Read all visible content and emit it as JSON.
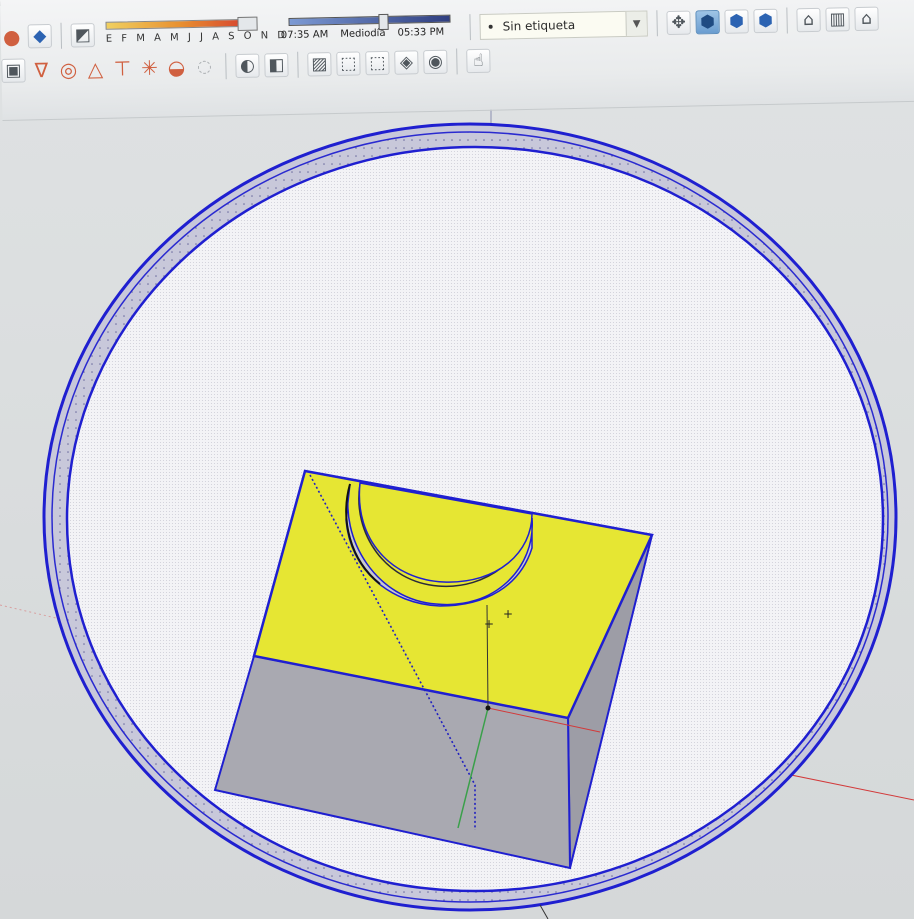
{
  "toolbar": {
    "months": "E F M A M J J A S O N D",
    "time_start": "07:35 AM",
    "time_mid": "Mediodía",
    "time_end": "05:33 PM",
    "tag_selected": "Sin etiqueta",
    "row1_tools": [
      {
        "name": "orbit-red-icon",
        "glyph": "●"
      },
      {
        "name": "component-icon",
        "glyph": "◆"
      },
      {
        "name": "eraser-icon",
        "glyph": "◩"
      }
    ],
    "view_tools": [
      {
        "name": "position-camera-icon",
        "glyph": "✥"
      },
      {
        "name": "view-iso-icon",
        "glyph": "⬢"
      },
      {
        "name": "view-top-icon",
        "glyph": "⬢"
      },
      {
        "name": "view-front-icon",
        "glyph": "⬢"
      },
      {
        "name": "warehouse-icon",
        "glyph": "⌂"
      },
      {
        "name": "extension-icon",
        "glyph": "▥"
      },
      {
        "name": "home-icon",
        "glyph": "⌂"
      }
    ],
    "row2_tools": [
      {
        "name": "photo-match-icon",
        "glyph": "▣"
      },
      {
        "name": "funnel-icon",
        "glyph": "∇"
      },
      {
        "name": "circle-target-icon",
        "glyph": "◎"
      },
      {
        "name": "triangle-icon",
        "glyph": "△"
      },
      {
        "name": "tack-icon",
        "glyph": "⊤"
      },
      {
        "name": "sun-icon",
        "glyph": "✳"
      },
      {
        "name": "drop-icon",
        "glyph": "◒"
      },
      {
        "name": "disabled-icon",
        "glyph": "◌"
      }
    ],
    "style_tools": [
      {
        "name": "shadow-icon",
        "glyph": "◐"
      },
      {
        "name": "fog-icon",
        "glyph": "◧"
      },
      {
        "name": "xray-icon",
        "glyph": "▨"
      },
      {
        "name": "wireframe-icon",
        "glyph": "⬚"
      },
      {
        "name": "hidden-line-icon",
        "glyph": "⬚"
      },
      {
        "name": "shaded-icon",
        "glyph": "◈"
      },
      {
        "name": "textured-icon",
        "glyph": "◉"
      },
      {
        "name": "monochrome-icon",
        "glyph": "⊕"
      },
      {
        "name": "select-tool-icon",
        "glyph": "☝"
      }
    ]
  },
  "colors": {
    "face_top": "#e6e633",
    "face_front": "#a9a9b1",
    "face_side": "#9d9da6",
    "edge_selected": "#1f1fd0",
    "disc_fill": "#f3f3f6",
    "hole_wall": "#c9c9d0",
    "axis_red": "#d23a3a",
    "axis_green": "#3aa04a"
  }
}
